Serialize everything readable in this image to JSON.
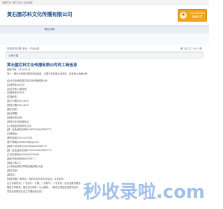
{
  "topbar": {
    "links": "收藏本站 | 官方主页 | 站内地图"
  },
  "header": {
    "title": "黄石盟芯科文化传播有限公司",
    "badge": {
      "icon": "star-icon",
      "line1": "Free Member",
      "line2": "普通会员"
    }
  },
  "nav": {
    "item": "默认分类"
  },
  "breadcrumb": "您现在的位置: 首页 > 产品分类",
  "pager": "第 1 页 共 1 页 10 条",
  "section": {
    "label": "公司介绍"
  },
  "article": {
    "title": "黄石盟芯科文化传播有限公司的工商信息",
    "lines": [
      "更新时间：2024-09-21",
      "简介：黄石为你维护服务热线电话，中国开发拓展业务系统，具有强大品牌价值，",
      "[企业名称]黄石盟芯科文化传播有限公司",
      "[注册资本]50万元",
      "[法定代表人]章余惠",
      "[注册资本]50万元",
      "[实缴资本]",
      "[成立日期]2021-06-27",
      "[核准日期]2021-06-27",
      "[登记机关]",
      "[营业期限]",
      "[经营状态]存续",
      "[所属行业]商务服务业",
      "[公司类型]有限责任公司",
      "[统一社会信用代码]91420200MA4F38R77X",
      "[注册地址]",
      "[联系电话]0714-6271932",
      "[电子邮箱]123456789@qq.com",
      "[纳税人识别号]91420200MA4F38R77X",
      "[统一社会信用代码]91420200MA4F38R77X",
      "[工商注册号]420200000076498",
      "[组织机构代码]MA4F38R7-7",
      "[参保人数]1人",
      "[公司地址]黄石市黄石港区黄石大道",
      "[英文名称]",
      "[曾用名]",
      "[经营范围]一般项目：组织文化艺术交流活动；文艺创作；",
      "企业形象策划；广告设计、代理；广告制作；广告发布；会议及展览服务；",
      "摄影扩印服务；图文设计制作；礼仪服务。（除依法须经批准的项目外，",
      "凭营业执照依法自主开展经营活动）"
    ]
  },
  "watermark": "秒收录啦.com"
}
